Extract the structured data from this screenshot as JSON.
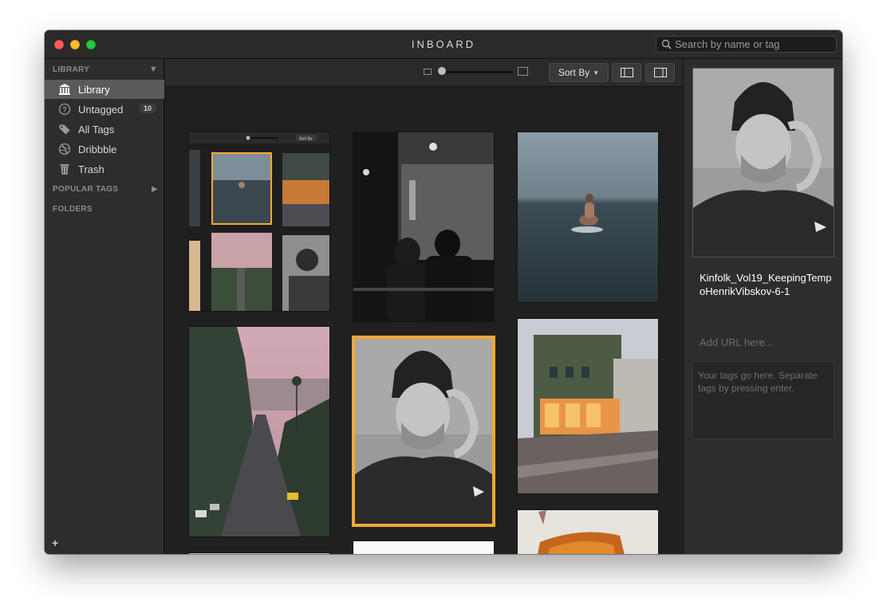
{
  "window": {
    "title": "INBOARD",
    "search_placeholder": "Search by name or tag"
  },
  "sidebar": {
    "library_header": "LIBRARY",
    "items": [
      {
        "label": "Library",
        "icon": "library-icon",
        "active": true
      },
      {
        "label": "Untagged",
        "icon": "question-circle-icon",
        "badge": "10"
      },
      {
        "label": "All Tags",
        "icon": "tag-icon"
      },
      {
        "label": "Dribbble",
        "icon": "dribbble-icon"
      },
      {
        "label": "Trash",
        "icon": "trash-icon"
      }
    ],
    "popular_tags_header": "POPULAR TAGS",
    "folders_header": "FOLDERS",
    "add_label": "+"
  },
  "toolbar": {
    "sort_label": "Sort By",
    "mini_sort_label": "Sort By",
    "zoom_level": 0.02
  },
  "grid": {
    "selected_index": 4,
    "images": [
      {
        "subject": "app screenshot"
      },
      {
        "subject": "couple at window"
      },
      {
        "subject": "surfer in fog"
      },
      {
        "subject": "street with palm trees"
      },
      {
        "subject": "man in beanie portrait"
      },
      {
        "subject": "paris cafe corner"
      },
      {
        "subject": "tree branches"
      },
      {
        "subject": "bright light"
      },
      {
        "subject": "grilled cheese sandwich"
      }
    ]
  },
  "inspector": {
    "filename": "Kinfolk_Vol19_KeepingTempoHenrikVibskov-6-1",
    "url_placeholder": "Add URL here...",
    "tags_placeholder": "Your tags go here. Separate tags by pressing enter."
  },
  "colors": {
    "accent_selected": "#f5a833",
    "sidebar_active": "#5a5a5a",
    "background": "#202020"
  }
}
